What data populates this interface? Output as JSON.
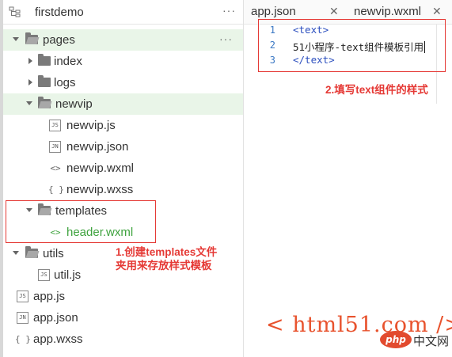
{
  "project": {
    "name": "firstdemo",
    "more": "···"
  },
  "tree": {
    "pages": "pages",
    "index": "index",
    "logs": "logs",
    "newvip": "newvip",
    "newvip_js": "newvip.js",
    "newvip_json": "newvip.json",
    "newvip_wxml": "newvip.wxml",
    "newvip_wxss": "newvip.wxss",
    "templates": "templates",
    "header_wxml": "header.wxml",
    "utils": "utils",
    "util_js": "util.js",
    "app_js": "app.js",
    "app_json": "app.json",
    "app_wxss": "app.wxss"
  },
  "icons": {
    "js": "JS",
    "json": "JN",
    "wxml": "<>",
    "wxss": "{ }"
  },
  "tabs": [
    {
      "label": "app.json",
      "close": "✕"
    },
    {
      "label": "newvip.wxml",
      "close": "✕"
    }
  ],
  "editor": {
    "lines": [
      {
        "num": "1",
        "text": "<text>"
      },
      {
        "num": "2",
        "text": "51小程序-text组件模板引用"
      },
      {
        "num": "3",
        "text": "</text>"
      }
    ]
  },
  "annotations": {
    "step1_line1": "1.创建templates文件",
    "step1_line2": "夹用来存放样式模板",
    "step2": "2.填写text组件的样式"
  },
  "watermark": {
    "text": "< html51.com />",
    "logo": "php",
    "site": "中文网"
  },
  "colors": {
    "accent_green": "#3fa33f",
    "annotation_red": "#e53935",
    "selected_bg": "#e9f5e8",
    "watermark": "#e8532e"
  }
}
